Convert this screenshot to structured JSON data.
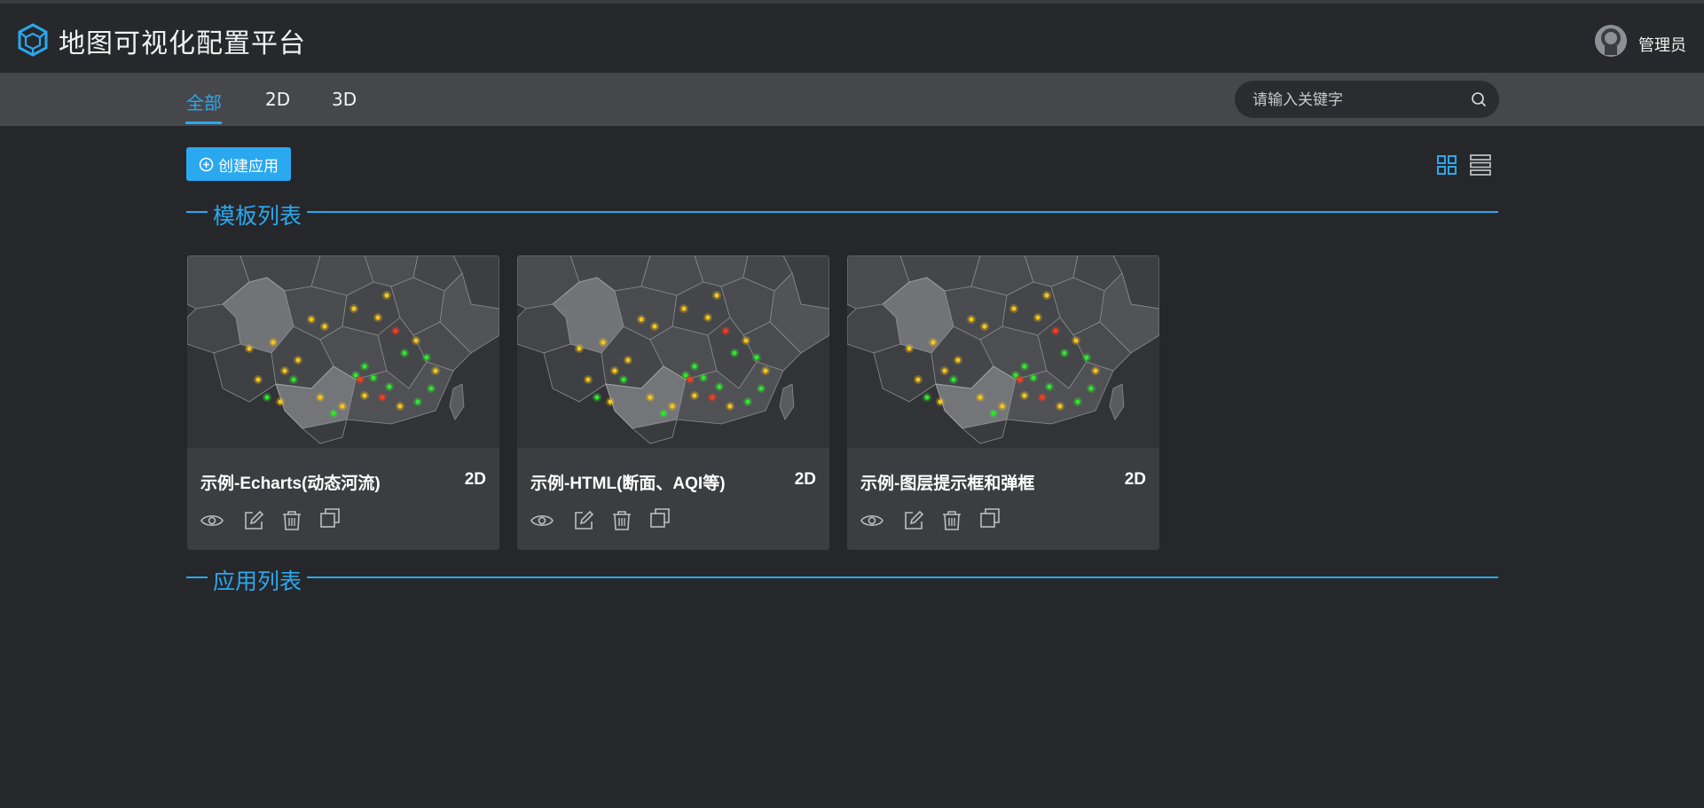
{
  "header": {
    "app_title": "地图可视化配置平台",
    "user_name": "管理员"
  },
  "tabs": [
    {
      "label": "全部",
      "active": true
    },
    {
      "label": "2D",
      "active": false
    },
    {
      "label": "3D",
      "active": false
    }
  ],
  "search": {
    "placeholder": "请输入关键字",
    "value": ""
  },
  "toolbar": {
    "create_label": "创建应用",
    "views": [
      "grid",
      "list"
    ],
    "active_view": "grid"
  },
  "sections": {
    "templates_title": "模板列表",
    "apps_title": "应用列表"
  },
  "templates": [
    {
      "name": "示例-Echarts(动态河流)",
      "type": "2D"
    },
    {
      "name": "示例-HTML(断面、AQI等)",
      "type": "2D"
    },
    {
      "name": "示例-图层提示框和弹框",
      "type": "2D"
    }
  ],
  "card_actions": [
    "view-icon",
    "edit-icon",
    "delete-icon",
    "copy-icon"
  ],
  "colors": {
    "accent": "#2aa8f0",
    "background": "#26272a",
    "tabbar": "#46474b",
    "card": "#3c3d41",
    "point_yellow": "#f5c518",
    "point_green": "#2ee82e",
    "point_red": "#ff3b1e"
  }
}
